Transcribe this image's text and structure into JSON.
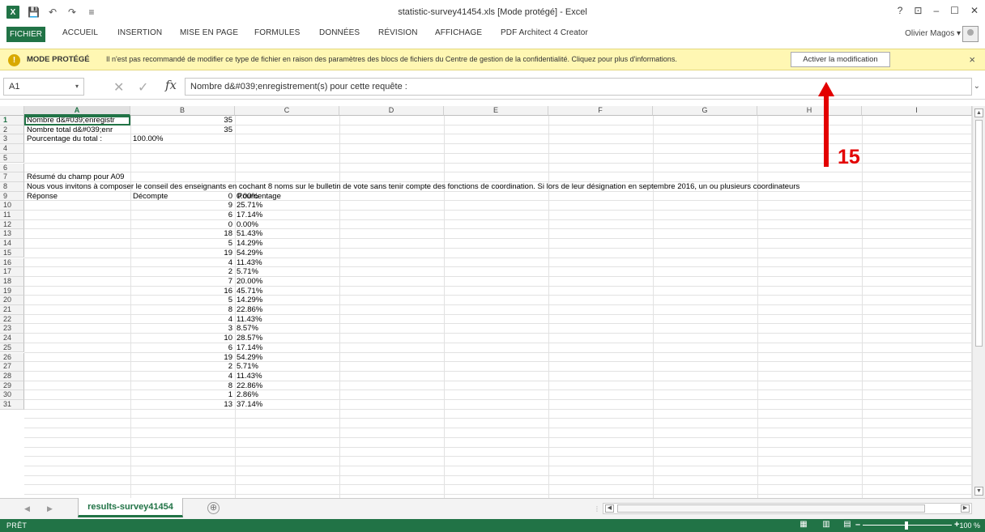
{
  "window": {
    "title": "statistic-survey41454.xls  [Mode protégé] - Excel",
    "controls": [
      "?",
      "⊡",
      "–",
      "☐",
      "✕"
    ]
  },
  "ribbon": {
    "tabs": [
      "FICHIER",
      "ACCUEIL",
      "INSERTION",
      "MISE EN PAGE",
      "FORMULES",
      "DONNÉES",
      "RÉVISION",
      "AFFICHAGE",
      "PDF Architect 4 Creator"
    ],
    "user": "Olivier Magos ▾"
  },
  "message_bar": {
    "title": "MODE PROTÉGÉ",
    "text": "Il n'est pas recommandé de modifier ce type de fichier en raison des paramètres des blocs de fichiers du Centre de gestion de la confidentialité. Cliquez pour plus d'informations.",
    "button": "Activer la modification",
    "close": "×",
    "icon_glyph": "!"
  },
  "formula_bar": {
    "name_box": "A1",
    "name_box_arrow": "▾",
    "cancel_glyph": "✕",
    "enter_glyph": "✓",
    "fx": "fx",
    "formula": "Nombre d&#039;enregistrement(s) pour cette requête :",
    "expand_glyph": "⌄"
  },
  "grid": {
    "columns": [
      "A",
      "B",
      "C",
      "D",
      "E",
      "F",
      "G",
      "H",
      "I"
    ],
    "selected_column": "A",
    "rows": [
      "1",
      "2",
      "3",
      "4",
      "5",
      "6",
      "7",
      "8",
      "9",
      "10",
      "11",
      "12",
      "13",
      "14",
      "15",
      "16",
      "17",
      "18",
      "19",
      "20",
      "21",
      "22",
      "23",
      "24",
      "25",
      "26",
      "27",
      "28",
      "29",
      "30",
      "31"
    ],
    "selected_row": "1",
    "cells": {
      "a1": "Nombre d&#039;enregistr",
      "b1": "35",
      "a2": "Nombre total d&#039;enr",
      "b2": "35",
      "a3": "Pourcentage du total :",
      "b3": "100.00%",
      "a6": "Résumé du champ pour A09",
      "a7": "Nous vous invitons à composer le conseil des enseignants en cochant 8 noms sur le bulletin de vote sans tenir compte des fonctions de coordination. Si lors de leur désignation en septembre 2016, un ou plusieurs coordinateurs",
      "a8": "Réponse",
      "b8": "Décompte",
      "c8": "Pourcentage"
    },
    "data_rows": [
      {
        "count": "0",
        "pct": "0.00%"
      },
      {
        "count": "9",
        "pct": "25.71%"
      },
      {
        "count": "6",
        "pct": "17.14%"
      },
      {
        "count": "0",
        "pct": "0.00%"
      },
      {
        "count": "18",
        "pct": "51.43%"
      },
      {
        "count": "5",
        "pct": "14.29%"
      },
      {
        "count": "19",
        "pct": "54.29%"
      },
      {
        "count": "4",
        "pct": "11.43%"
      },
      {
        "count": "2",
        "pct": "5.71%"
      },
      {
        "count": "7",
        "pct": "20.00%"
      },
      {
        "count": "16",
        "pct": "45.71%"
      },
      {
        "count": "5",
        "pct": "14.29%"
      },
      {
        "count": "8",
        "pct": "22.86%"
      },
      {
        "count": "4",
        "pct": "11.43%"
      },
      {
        "count": "3",
        "pct": "8.57%"
      },
      {
        "count": "10",
        "pct": "28.57%"
      },
      {
        "count": "6",
        "pct": "17.14%"
      },
      {
        "count": "19",
        "pct": "54.29%"
      },
      {
        "count": "2",
        "pct": "5.71%"
      },
      {
        "count": "4",
        "pct": "11.43%"
      },
      {
        "count": "8",
        "pct": "22.86%"
      },
      {
        "count": "1",
        "pct": "2.86%"
      },
      {
        "count": "13",
        "pct": "37.14%"
      }
    ]
  },
  "sheet_tabs": {
    "active": "results-survey41454",
    "add": "⊕",
    "nav_prev": "◀",
    "nav_next": "▶"
  },
  "status": {
    "text": "PRÊT",
    "zoom": "100 %",
    "zoom_minus": "–",
    "zoom_plus": "+"
  },
  "annotation": {
    "label": "15",
    "color": "#e30000"
  },
  "colors": {
    "excel_green": "#217346",
    "message_bar": "#fff7b3",
    "annotation_red": "#e30000"
  }
}
